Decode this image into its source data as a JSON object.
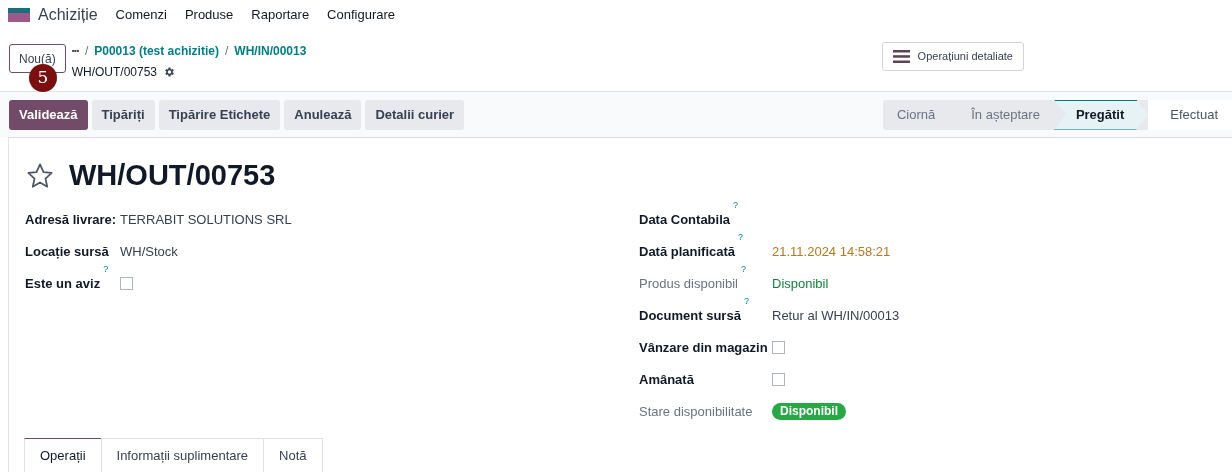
{
  "navbar": {
    "app": "Achiziție",
    "menu": [
      "Comenzi",
      "Produse",
      "Raportare",
      "Configurare"
    ]
  },
  "control_panel": {
    "new_button": "Nou(ă)",
    "step_badge": "5",
    "breadcrumbs": [
      {
        "kind": "more",
        "text": "•••"
      },
      {
        "kind": "separator",
        "text": "/"
      },
      {
        "kind": "link",
        "text": "P00013 (test achizitie)"
      },
      {
        "kind": "separator",
        "text": "/"
      },
      {
        "kind": "link",
        "text": "WH/IN/00013"
      }
    ],
    "current": "WH/OUT/00753",
    "detail_button": "Operațiuni detaliate"
  },
  "actions": [
    {
      "label": "Validează",
      "primary": true
    },
    {
      "label": "Tipăriți",
      "primary": false
    },
    {
      "label": "Tipărire Etichete",
      "primary": false
    },
    {
      "label": "Anulează",
      "primary": false
    },
    {
      "label": "Detalii curier",
      "primary": false
    }
  ],
  "statusbar": [
    {
      "label": "Ciornă",
      "selected": false
    },
    {
      "label": "În așteptare",
      "selected": false
    },
    {
      "label": "Pregătit",
      "selected": true
    },
    {
      "label": "Efectuat",
      "selected": false
    }
  ],
  "form": {
    "title": "WH/OUT/00753",
    "favorite": false,
    "left": [
      {
        "label": "Adresă livrare:",
        "kind": "text",
        "value": "TERRABIT SOLUTIONS SRL",
        "muted": false
      },
      {
        "label": "Locație sursă",
        "kind": "text",
        "value": "WH/Stock",
        "muted": false
      },
      {
        "label": "Este un aviz",
        "help": "?",
        "kind": "checkbox",
        "checked": false,
        "muted": false
      }
    ],
    "right": [
      {
        "label": "Data Contabila",
        "help": "?",
        "kind": "empty",
        "muted": false
      },
      {
        "label": "Dată planificată",
        "help": "?",
        "kind": "date",
        "value": "21.11.2024 14:58:21",
        "muted": false
      },
      {
        "label": "Produs disponibil",
        "help": "?",
        "kind": "status",
        "value": "Disponibil",
        "muted": true
      },
      {
        "label": "Document sursă",
        "help": "?",
        "kind": "text",
        "value": "Retur al WH/IN/00013",
        "muted": false
      },
      {
        "label": "Vânzare din magazin",
        "kind": "checkbox",
        "checked": false,
        "muted": false
      },
      {
        "label": "Amânată",
        "kind": "checkbox",
        "checked": false,
        "muted": false
      },
      {
        "label": "Stare disponibilitate",
        "kind": "badge",
        "value": "Disponibil",
        "muted": true
      }
    ],
    "tabs": [
      {
        "label": "Operații",
        "selected": true
      },
      {
        "label": "Informații suplimentare",
        "selected": false
      },
      {
        "label": "Notă",
        "selected": false
      }
    ]
  }
}
